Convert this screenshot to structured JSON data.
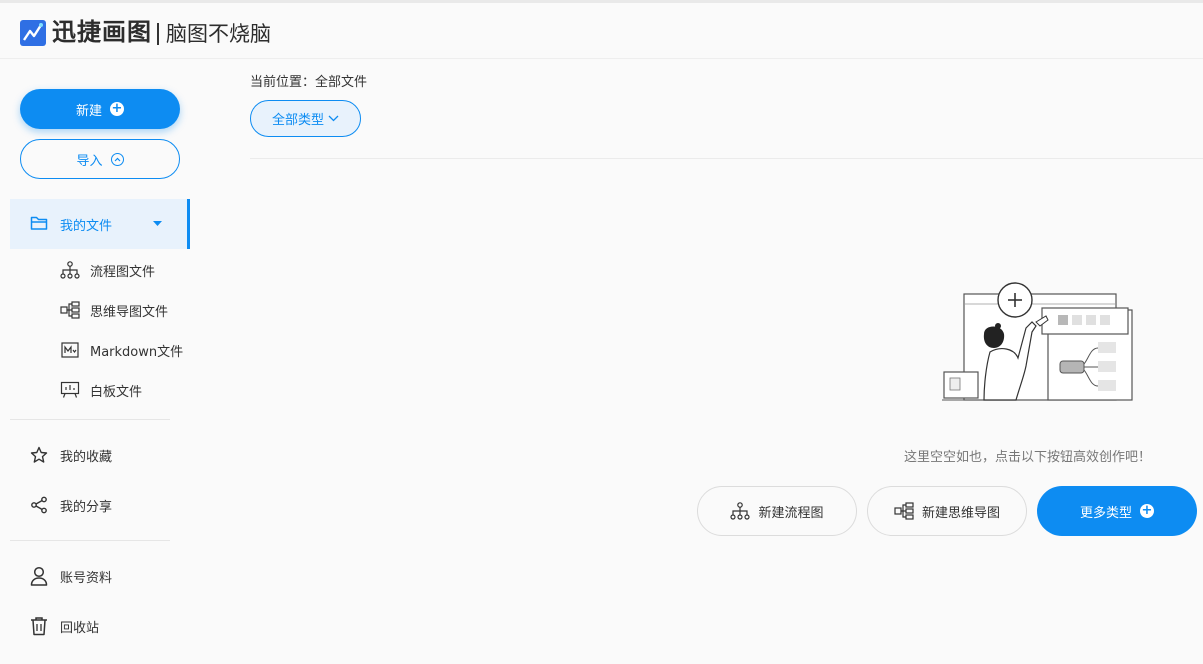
{
  "header": {
    "brand": "迅捷画图",
    "slogan": "脑图不烧脑"
  },
  "sidebar": {
    "new_label": "新建",
    "import_label": "导入",
    "my_files_label": "我的文件",
    "sub_items": {
      "flowchart": "流程图文件",
      "mindmap": "思维导图文件",
      "markdown": "Markdown文件",
      "whiteboard": "白板文件"
    },
    "favorites_label": "我的收藏",
    "shares_label": "我的分享",
    "account_label": "账号资料",
    "trash_label": "回收站"
  },
  "main": {
    "breadcrumb": "当前位置：全部文件",
    "filter_label": "全部类型",
    "empty_text": "这里空空如也，点击以下按钮高效创作吧！",
    "actions": {
      "new_flowchart": "新建流程图",
      "new_mindmap": "新建思维导图",
      "more_types": "更多类型"
    }
  },
  "colors": {
    "accent": "#0d8cf2",
    "active_bg": "#e8f2fc"
  }
}
